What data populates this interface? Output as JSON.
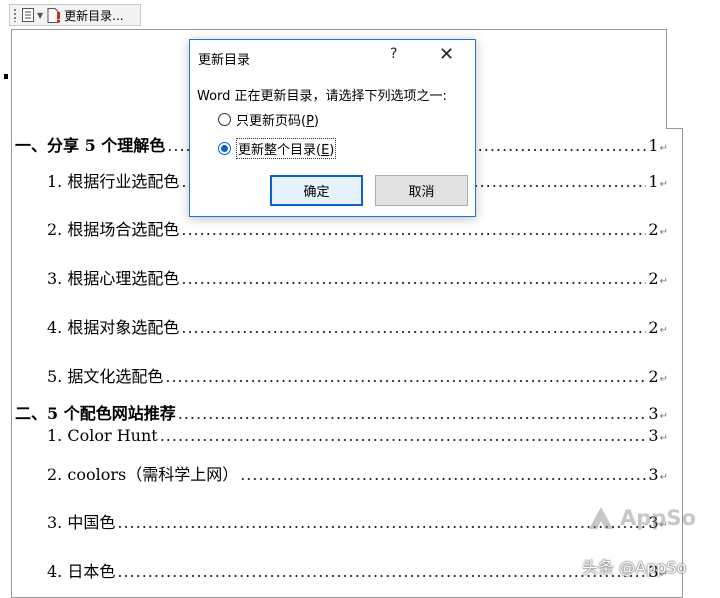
{
  "toolbar": {
    "label": "更新目录..."
  },
  "toc": [
    {
      "label": "一、分享 5 个理解色",
      "page": "1",
      "level": 1
    },
    {
      "label": "1.  根据行业选配色",
      "page": "1",
      "level": 2
    },
    {
      "label": "2.  根据场合选配色",
      "page": "2",
      "level": 2
    },
    {
      "label": "3.  根据心理选配色",
      "page": "2",
      "level": 2
    },
    {
      "label": "4.  根据对象选配色",
      "page": "2",
      "level": 2
    },
    {
      "label": "5.  据文化选配色",
      "page": "2",
      "level": 2
    },
    {
      "label": "二、5 个配色网站推荐",
      "page": "3",
      "level": 1
    },
    {
      "label": "1. Color Hunt",
      "page": "3",
      "level": 2
    },
    {
      "label": "2. coolors（需科学上网）",
      "page": "3",
      "level": 2
    },
    {
      "label": "3.  中国色",
      "page": "3",
      "level": 2
    },
    {
      "label": "4.  日本色",
      "page": "3",
      "level": 2
    }
  ],
  "dialog": {
    "title": "更新目录",
    "help": "?",
    "close": "✕",
    "message": "Word 正在更新目录，请选择下列选项之一:",
    "option1": {
      "text": "只更新页码(",
      "key": "P",
      "end": ")",
      "checked": false
    },
    "option2": {
      "text": "更新整个目录(",
      "key": "E",
      "end": ")",
      "checked": true
    },
    "ok_label": "确定",
    "cancel_label": "取消"
  },
  "watermark": {
    "logo_text": "AppSo",
    "byline": "头条 @AppSo"
  }
}
